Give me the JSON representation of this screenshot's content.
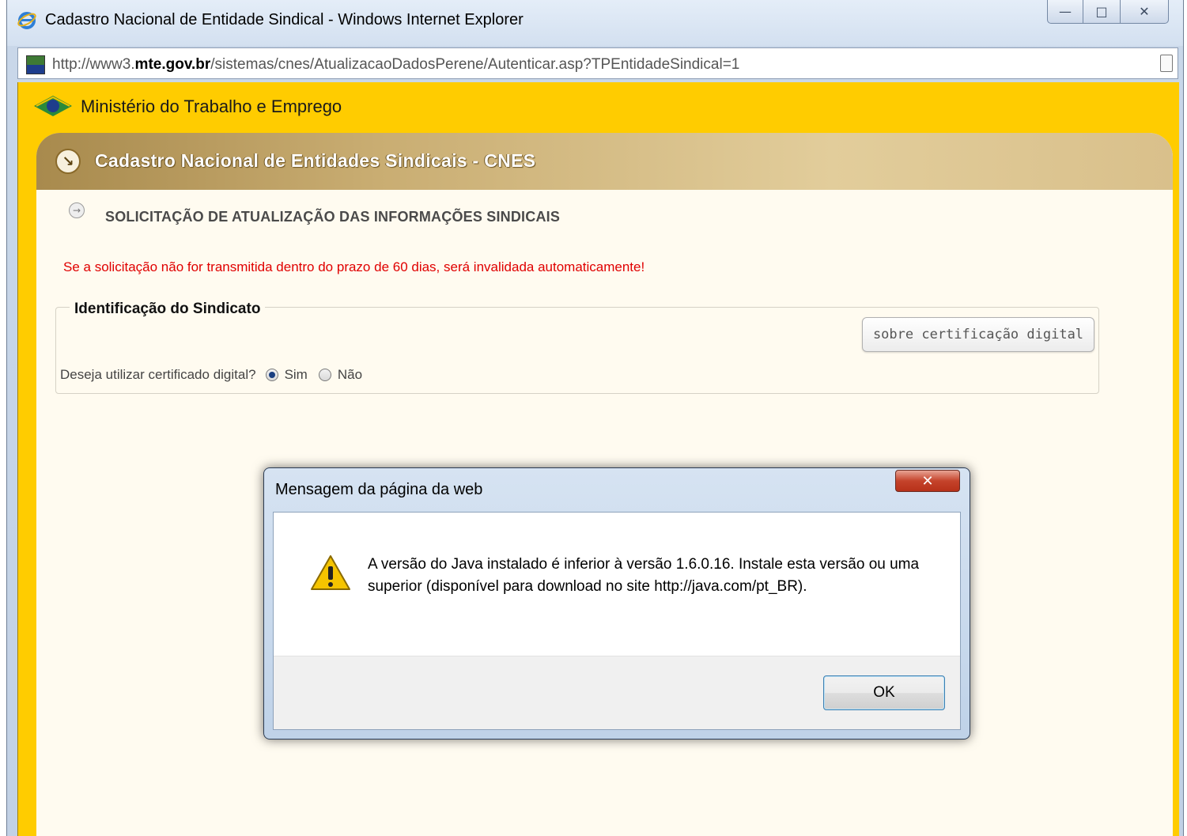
{
  "browser": {
    "title": "Cadastro Nacional de Entidade Sindical - Windows Internet Explorer",
    "url_prefix": "http://www3.",
    "url_domain": "mte.gov.br",
    "url_path": "/sistemas/cnes/AtualizacaoDadosPerene/Autenticar.asp?TPEntidadeSindical=1",
    "buttons": {
      "minimize": "—",
      "maximize": "□",
      "close": "✕"
    }
  },
  "page": {
    "ministry": "Ministério do Trabalho e Emprego",
    "header_title": "Cadastro Nacional de Entidades Sindicais - CNES",
    "header_arrow": "↘",
    "section_arrow": "→",
    "section_title": "SOLICITAÇÃO DE ATUALIZAÇÃO DAS INFORMAÇÕES SINDICAIS",
    "warning": "Se a solicitação não for transmitida dentro do prazo de 60 dias, será invalidada automaticamente!",
    "fieldset_legend": "Identificação do Sindicato",
    "cert_button": "sobre certificação digital",
    "question": "Deseja utilizar certificado digital?",
    "options": [
      {
        "label": "Sim",
        "selected": true
      },
      {
        "label": "Não",
        "selected": false
      }
    ]
  },
  "dialog": {
    "title": "Mensagem da página da web",
    "close": "✕",
    "message": "A versão do Java instalado é inferior à versão 1.6.0.16. Instale esta versão ou uma superior (disponível para download no site http://java.com/pt_BR).",
    "ok": "OK"
  },
  "colors": {
    "page_yellow": "#ffcc00",
    "warning_red": "#e00000",
    "content_bg": "#fffbf0"
  }
}
